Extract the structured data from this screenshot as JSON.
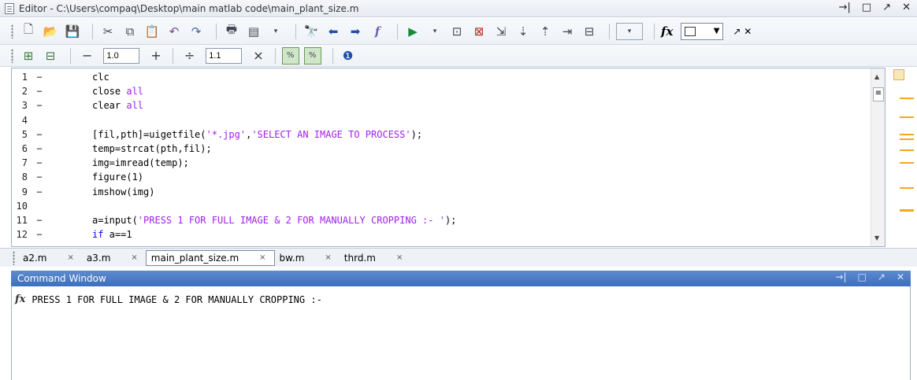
{
  "editor": {
    "title": "Editor - C:\\Users\\compaq\\Desktop\\main matlab code\\main_plant_size.m",
    "window_controls": [
      "→|",
      "□",
      "↗",
      "✕"
    ]
  },
  "toolbar2": {
    "step_minus": "−",
    "step1_value": "1.0",
    "step_plus": "+",
    "step_divide": "÷",
    "step2_value": "1.1",
    "step_times": "×"
  },
  "code_lines": [
    {
      "num": "1",
      "dash": "−",
      "code": "clc"
    },
    {
      "num": "2",
      "dash": "−",
      "code": "close all"
    },
    {
      "num": "3",
      "dash": "−",
      "code": "clear all"
    },
    {
      "num": "4",
      "dash": "",
      "code": ""
    },
    {
      "num": "5",
      "dash": "−",
      "code": "[fil,pth]=uigetfile('*.jpg','SELECT AN IMAGE TO PROCESS');"
    },
    {
      "num": "6",
      "dash": "−",
      "code": "temp=strcat(pth,fil);"
    },
    {
      "num": "7",
      "dash": "−",
      "code": "img=imread(temp);"
    },
    {
      "num": "8",
      "dash": "−",
      "code": "figure(1)"
    },
    {
      "num": "9",
      "dash": "−",
      "code": "imshow(img)"
    },
    {
      "num": "10",
      "dash": "",
      "code": ""
    },
    {
      "num": "11",
      "dash": "−",
      "code": "a=input('PRESS 1 FOR FULL IMAGE & 2 FOR MANUALLY CROPPING :- ');"
    },
    {
      "num": "12",
      "dash": "−",
      "code": "if a==1"
    }
  ],
  "tabs": [
    {
      "label": "a2.m",
      "active": false
    },
    {
      "label": "a3.m",
      "active": false
    },
    {
      "label": "main_plant_size.m",
      "active": true
    },
    {
      "label": "bw.m",
      "active": false
    },
    {
      "label": "thrd.m",
      "active": false
    }
  ],
  "command_window": {
    "title": "Command Window",
    "prompt_symbol": "fx",
    "output": "PRESS 1 FOR FULL IMAGE & 2 FOR MANUALLY CROPPING :-"
  }
}
